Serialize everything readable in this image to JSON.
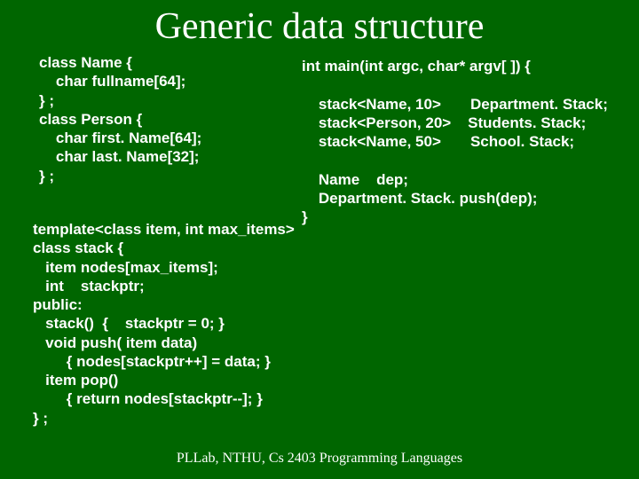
{
  "title": "Generic data structure",
  "left_code": "class Name {\n    char fullname[64];\n} ;\nclass Person {\n    char first. Name[64];\n    char last. Name[32];\n} ;",
  "right_code": "int main(int argc, char* argv[ ]) {\n\n    stack<Name, 10>       Department. Stack;\n    stack<Person, 20>    Students. Stack;\n    stack<Name, 50>       School. Stack;\n\n    Name    dep;\n    Department. Stack. push(dep);\n}",
  "template_code": "template<class item, int max_items>\nclass stack {\n   item nodes[max_items];\n   int    stackptr;\npublic:\n   stack()  {    stackptr = 0; }\n   void push( item data)\n        { nodes[stackptr++] = data; }\n   item pop()\n        { return nodes[stackptr--]; }\n} ;",
  "footer": "PLLab, NTHU, Cs 2403 Programming Languages"
}
